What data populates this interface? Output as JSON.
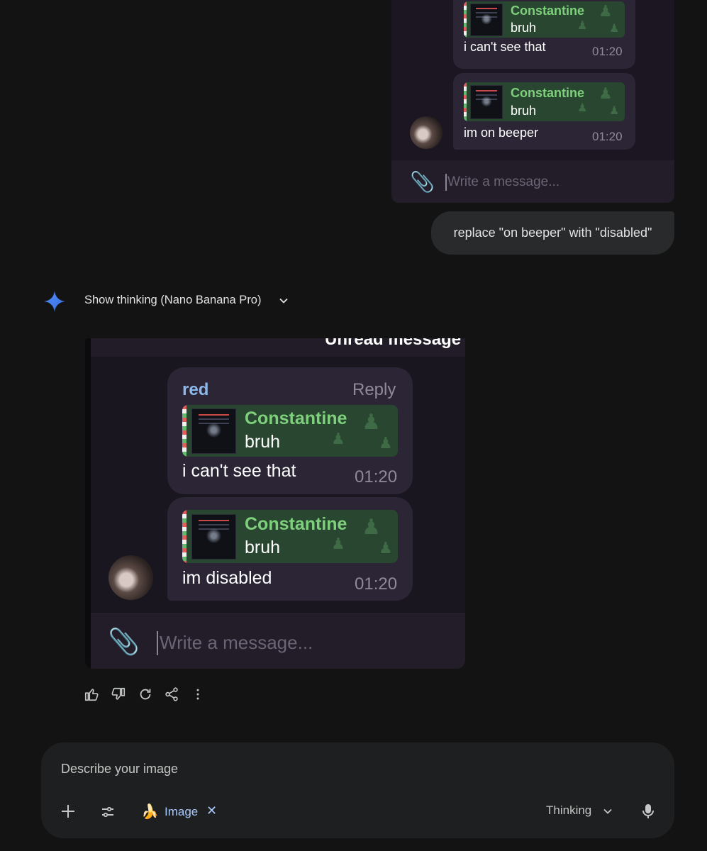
{
  "top_preview": {
    "bubble1": {
      "quote_name": "Constantine",
      "quote_text": "bruh",
      "message": "i can't see that",
      "time": "01:20"
    },
    "bubble2": {
      "quote_name": "Constantine",
      "quote_text": "bruh",
      "message": "im on beeper",
      "time": "01:20"
    },
    "input_placeholder": "Write a message..."
  },
  "user_message": "replace \"on beeper\" with \"disabled\"",
  "thinking_toggle": "Show thinking (Nano Banana Pro)",
  "generated_image": {
    "header_text": "Unread message",
    "bubble1": {
      "sender": "red",
      "reply": "Reply",
      "quote_name": "Constantine",
      "quote_text": "bruh",
      "message": "i can't see that",
      "time": "01:20"
    },
    "bubble2": {
      "quote_name": "Constantine",
      "quote_text": "bruh",
      "message": "im disabled",
      "time": "01:20"
    },
    "input_placeholder": "Write a message..."
  },
  "response_actions": [
    "thumbs-up",
    "thumbs-down",
    "regenerate",
    "share",
    "more"
  ],
  "composer": {
    "placeholder": "Describe your image",
    "chip_emoji": "🍌",
    "chip_label": "Image",
    "chip_close": "✕",
    "mode_label": "Thinking"
  },
  "colors": {
    "background": "#131313",
    "accent_blue": "#a8c7fa",
    "quote_green": "#7fd07d"
  }
}
